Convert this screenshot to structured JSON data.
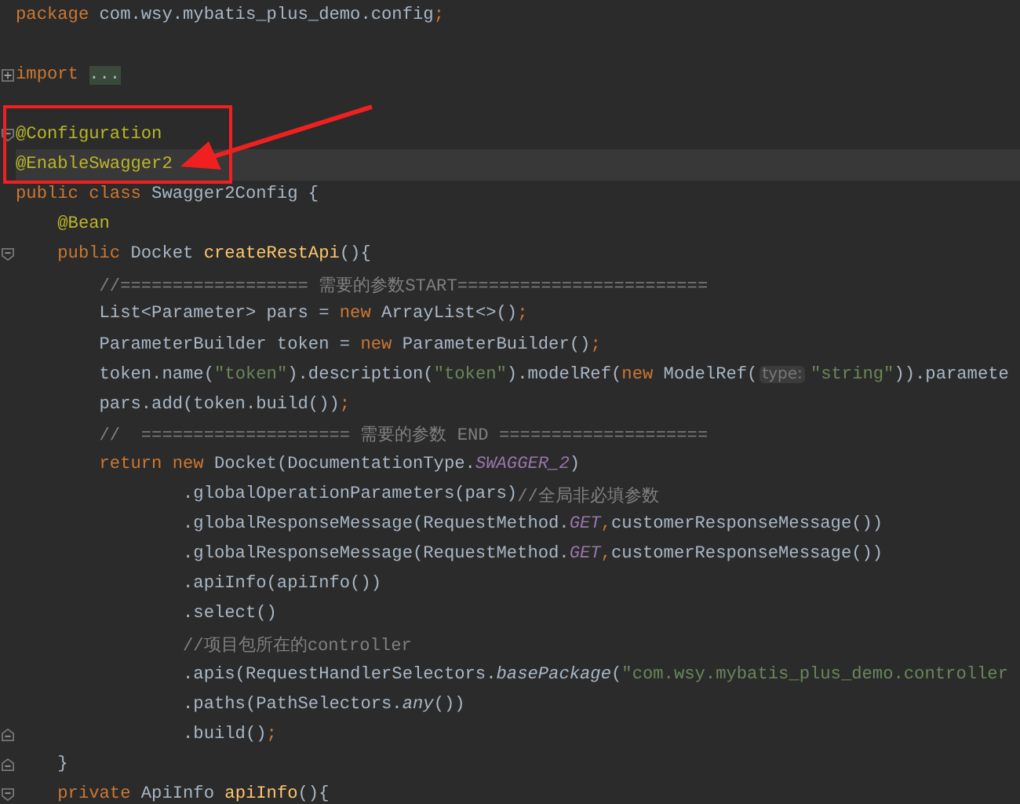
{
  "editor": {
    "lines": [
      {
        "kind": "code",
        "current": false,
        "tokens": [
          {
            "kind": "keyword",
            "text": "package "
          },
          {
            "kind": "plain",
            "text": "com.wsy.mybatis_plus_demo.config"
          },
          {
            "kind": "keyword",
            "text": ";"
          }
        ]
      },
      {
        "kind": "blank"
      },
      {
        "kind": "code",
        "current": false,
        "fold": {
          "kind": "expand"
        },
        "tokens": [
          {
            "kind": "keyword",
            "text": "import "
          },
          {
            "kind": "folded",
            "text": "..."
          }
        ]
      },
      {
        "kind": "blank"
      },
      {
        "kind": "code",
        "current": false,
        "fold": {
          "kind": "start"
        },
        "tokens": [
          {
            "kind": "annotation",
            "text": "@Configuration"
          }
        ]
      },
      {
        "kind": "code",
        "current": true,
        "tokens": [
          {
            "kind": "annotation",
            "text": "@EnableSwagger2"
          }
        ]
      },
      {
        "kind": "code",
        "current": false,
        "tokens": [
          {
            "kind": "keyword",
            "text": "public class "
          },
          {
            "kind": "plain",
            "text": "Swagger2Config {"
          }
        ]
      },
      {
        "kind": "code",
        "current": false,
        "tokens": [
          {
            "kind": "annotation",
            "text": "    @Bean"
          }
        ]
      },
      {
        "kind": "code",
        "current": false,
        "fold": {
          "kind": "start"
        },
        "tokens": [
          {
            "kind": "keyword",
            "text": "    public "
          },
          {
            "kind": "plain",
            "text": "Docket "
          },
          {
            "kind": "function",
            "text": "createRestApi"
          },
          {
            "kind": "plain",
            "text": "(){"
          }
        ]
      },
      {
        "kind": "code",
        "current": false,
        "tokens": [
          {
            "kind": "comment",
            "text": "        //================== 需要的参数START========================"
          }
        ]
      },
      {
        "kind": "code",
        "current": false,
        "tokens": [
          {
            "kind": "plain",
            "text": "        List<Parameter> pars = "
          },
          {
            "kind": "keyword",
            "text": "new "
          },
          {
            "kind": "plain",
            "text": "ArrayList<>()"
          },
          {
            "kind": "keyword",
            "text": ";"
          }
        ]
      },
      {
        "kind": "code",
        "current": false,
        "tokens": [
          {
            "kind": "plain",
            "text": "        ParameterBuilder token = "
          },
          {
            "kind": "keyword",
            "text": "new "
          },
          {
            "kind": "plain",
            "text": "ParameterBuilder()"
          },
          {
            "kind": "keyword",
            "text": ";"
          }
        ]
      },
      {
        "kind": "code",
        "current": false,
        "tokens": [
          {
            "kind": "plain",
            "text": "        token.name("
          },
          {
            "kind": "string",
            "text": "\"token\""
          },
          {
            "kind": "plain",
            "text": ").description("
          },
          {
            "kind": "string",
            "text": "\"token\""
          },
          {
            "kind": "plain",
            "text": ").modelRef("
          },
          {
            "kind": "keyword",
            "text": "new "
          },
          {
            "kind": "plain",
            "text": "ModelRef("
          },
          {
            "kind": "hint",
            "text": "type:"
          },
          {
            "kind": "string",
            "text": "\"string\""
          },
          {
            "kind": "plain",
            "text": ")).paramete"
          }
        ]
      },
      {
        "kind": "code",
        "current": false,
        "tokens": [
          {
            "kind": "plain",
            "text": "        pars.add(token.build())"
          },
          {
            "kind": "keyword",
            "text": ";"
          }
        ]
      },
      {
        "kind": "code",
        "current": false,
        "tokens": [
          {
            "kind": "comment",
            "text": "        //  ==================== 需要的参数 END ===================="
          }
        ]
      },
      {
        "kind": "code",
        "current": false,
        "tokens": [
          {
            "kind": "keyword",
            "text": "        return new "
          },
          {
            "kind": "plain",
            "text": "Docket(DocumentationType."
          },
          {
            "kind": "constant",
            "text": "SWAGGER_2"
          },
          {
            "kind": "plain",
            "text": ")"
          }
        ]
      },
      {
        "kind": "code",
        "current": false,
        "tokens": [
          {
            "kind": "plain",
            "text": "                .globalOperationParameters(pars)"
          },
          {
            "kind": "comment",
            "text": "//全局非必填参数"
          }
        ]
      },
      {
        "kind": "code",
        "current": false,
        "tokens": [
          {
            "kind": "plain",
            "text": "                .globalResponseMessage(RequestMethod."
          },
          {
            "kind": "constant",
            "text": "GET"
          },
          {
            "kind": "keyword",
            "text": ","
          },
          {
            "kind": "plain",
            "text": "customerResponseMessage())"
          }
        ]
      },
      {
        "kind": "code",
        "current": false,
        "tokens": [
          {
            "kind": "plain",
            "text": "                .globalResponseMessage(RequestMethod."
          },
          {
            "kind": "constant",
            "text": "GET"
          },
          {
            "kind": "keyword",
            "text": ","
          },
          {
            "kind": "plain",
            "text": "customerResponseMessage())"
          }
        ]
      },
      {
        "kind": "code",
        "current": false,
        "tokens": [
          {
            "kind": "plain",
            "text": "                .apiInfo(apiInfo())"
          }
        ]
      },
      {
        "kind": "code",
        "current": false,
        "tokens": [
          {
            "kind": "plain",
            "text": "                .select()"
          }
        ]
      },
      {
        "kind": "code",
        "current": false,
        "tokens": [
          {
            "kind": "comment",
            "text": "                //项目包所在的controller"
          }
        ]
      },
      {
        "kind": "code",
        "current": false,
        "tokens": [
          {
            "kind": "plain",
            "text": "                .apis(RequestHandlerSelectors."
          },
          {
            "kind": "static",
            "text": "basePackage"
          },
          {
            "kind": "plain",
            "text": "("
          },
          {
            "kind": "string",
            "text": "\"com.wsy.mybatis_plus_demo.controller"
          }
        ]
      },
      {
        "kind": "code",
        "current": false,
        "tokens": [
          {
            "kind": "plain",
            "text": "                .paths(PathSelectors."
          },
          {
            "kind": "static",
            "text": "any"
          },
          {
            "kind": "plain",
            "text": "())"
          }
        ]
      },
      {
        "kind": "code",
        "current": false,
        "fold": {
          "kind": "end"
        },
        "tokens": [
          {
            "kind": "plain",
            "text": "                .build()"
          },
          {
            "kind": "keyword",
            "text": ";"
          }
        ]
      },
      {
        "kind": "code",
        "current": false,
        "fold": {
          "kind": "end"
        },
        "tokens": [
          {
            "kind": "plain",
            "text": "    }"
          }
        ]
      },
      {
        "kind": "code",
        "current": false,
        "fold": {
          "kind": "start"
        },
        "tokens": [
          {
            "kind": "keyword",
            "text": "    private "
          },
          {
            "kind": "plain",
            "text": "ApiInfo "
          },
          {
            "kind": "function",
            "text": "apiInfo"
          },
          {
            "kind": "plain",
            "text": "(){"
          }
        ]
      }
    ]
  }
}
